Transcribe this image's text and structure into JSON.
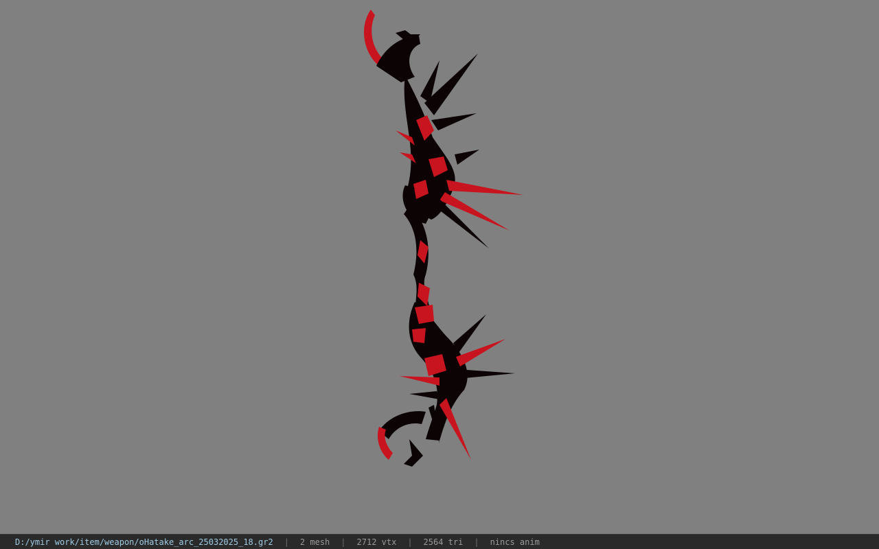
{
  "viewport": {
    "background_color": "#808080",
    "model_colors": {
      "dark": "#0b0304",
      "accent": "#c8141e"
    }
  },
  "status": {
    "file_path": "D:/ymir work/item/weapon/oHatake_arc_25032025_18.gr2",
    "separator": "|",
    "mesh_count": "2 mesh",
    "vertex_count": "2712 vtx",
    "triangle_count": "2564 tri",
    "anim_status": "nincs anim"
  }
}
